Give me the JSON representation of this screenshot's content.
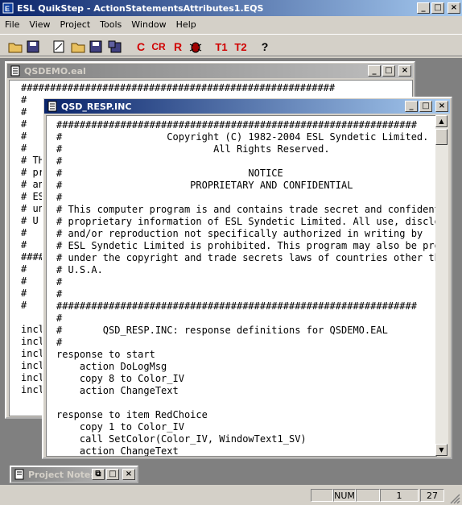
{
  "app": {
    "title": "ESL QuikStep - ActionStatementsAttributes1.EQS",
    "min_glyph": "_",
    "max_glyph": "□",
    "close_glyph": "×"
  },
  "menu": [
    "File",
    "View",
    "Project",
    "Tools",
    "Window",
    "Help"
  ],
  "toolbar": {
    "c_label": "C",
    "cr_label": "CR",
    "r_label": "R",
    "t1_label": "T1",
    "t2_label": "T2",
    "help_label": "?"
  },
  "qsdemo": {
    "title": "QSDEMO.eal",
    "lines": [
      "######################################################",
      "#",
      "#",
      "#",
      "#",
      "#",
      "# TH",
      "# pr",
      "# an",
      "# ES",
      "# un",
      "# U",
      "#",
      "#",
      "####",
      "#",
      "#",
      "#",
      "#",
      "",
      "incl",
      "incl",
      "incl",
      "incl",
      "incl",
      "incl"
    ]
  },
  "resp": {
    "title": "QSD_RESP.INC",
    "lines": [
      "##############################################################",
      "#                  Copyright (C) 1982-2004 ESL Syndetic Limited.",
      "#                          All Rights Reserved.",
      "#",
      "#                                NOTICE",
      "#                      PROPRIETARY AND CONFIDENTIAL",
      "#",
      "# This computer program is and contains trade secret and confidential",
      "# proprietary information of ESL Syndetic Limited. All use, disclosure,",
      "# and/or reproduction not specifically authorized in writing by",
      "# ESL Syndetic Limited is prohibited. This program may also be protected",
      "# under the copyright and trade secrets laws of countries other than",
      "# U.S.A.",
      "#",
      "#",
      "##############################################################",
      "#",
      "#       QSD_RESP.INC: response definitions for QSDEMO.EAL",
      "#",
      "response to start",
      "    action DoLogMsg",
      "    copy 8 to Color_IV",
      "    action ChangeText",
      "",
      "response to item RedChoice",
      "    copy 1 to Color_IV",
      "    call SetColor(Color_IV, WindowText1_SV)",
      "    action ChangeText"
    ]
  },
  "notes": {
    "title": "Project Notes"
  },
  "status": {
    "num": "NUM",
    "line": "1",
    "col": "27"
  }
}
